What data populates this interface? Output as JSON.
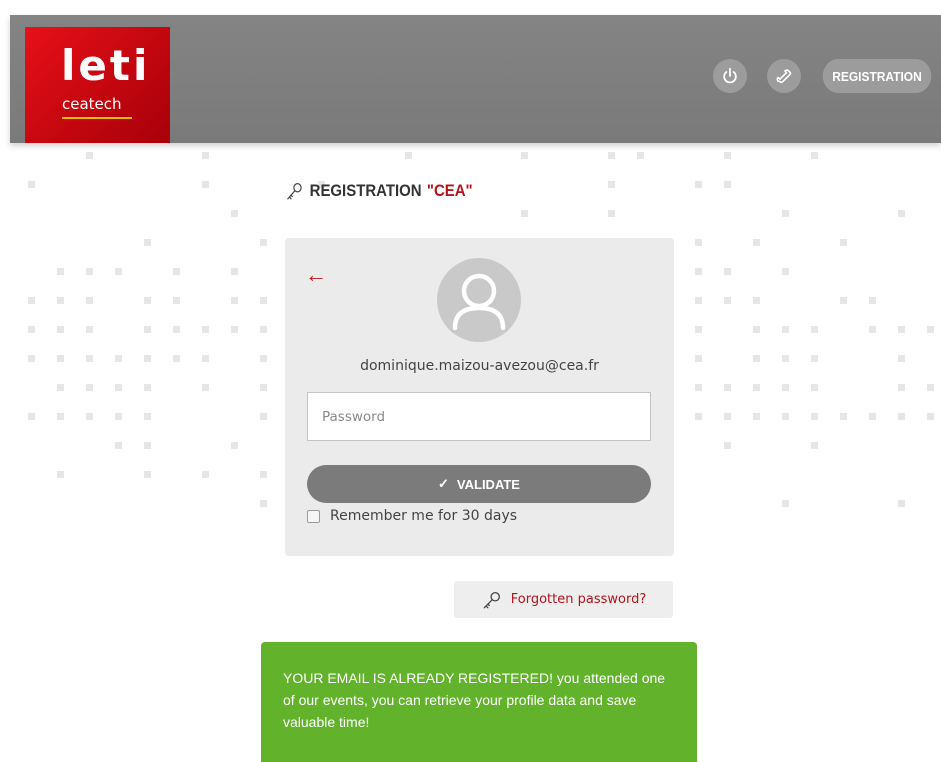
{
  "header": {
    "logo_main": "leti",
    "logo_sub": "ceatech",
    "power_icon": "power-icon",
    "phone_icon": "phone-icon",
    "registration_label": "REGISTRATION"
  },
  "page": {
    "title_prefix": "REGISTRATION ",
    "title_org": "\"CEA\"",
    "title_icon": "key-icon"
  },
  "login": {
    "back_icon": "←",
    "avatar_icon": "user-icon",
    "email": "dominique.maizou-avezou@cea.fr",
    "password_placeholder": "Password",
    "password_value": "",
    "validate_check": "✓",
    "validate_label": "VALIDATE",
    "remember_label": "Remember me for 30 days",
    "remember_checked": false
  },
  "forgot": {
    "icon": "key-icon",
    "label": "Forgotten password?"
  },
  "notice": {
    "text": "YOUR EMAIL IS ALREADY REGISTERED! you attended one of our events, you can retrieve your profile data and save valuable time!"
  },
  "colors": {
    "brand_red": "#b5121b",
    "logo_red": "#e8101a",
    "header_gray": "#7f7f7f",
    "button_gray": "#7b7b7b",
    "card_bg": "#ebebeb",
    "notice_green": "#62b22b"
  }
}
